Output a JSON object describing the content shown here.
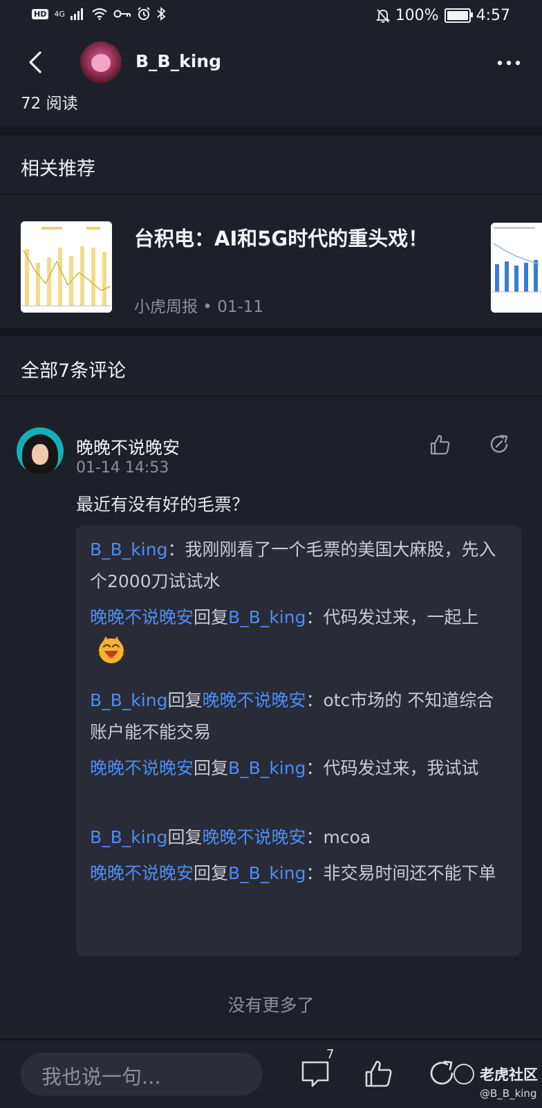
{
  "status_bar": {
    "network": "HD",
    "signal_label": "4G",
    "battery": "100%",
    "time": "4:57"
  },
  "header": {
    "username": "B_B_king",
    "reads": "72 阅读"
  },
  "recommend": {
    "section_title": "相关推荐",
    "item": {
      "title": "台积电：AI和5G时代的重头戏！",
      "meta": "小虎周报 • 01-11"
    }
  },
  "comments": {
    "section_title": "全部7条评论",
    "comment": {
      "author": "晚晚不说晚安",
      "time": "01-14 14:53",
      "text": "最近有没有好的毛票？",
      "replies": [
        {
          "user": "B_B_king",
          "verb": "",
          "target": "",
          "sep": "：",
          "text": "我刚刚看了一个毛票的美国大麻股，先入个2000刀试试水"
        },
        {
          "user": "晚晚不说晚安",
          "verb": "回复",
          "target": "B_B_king",
          "sep": "：",
          "text": "代码发过来，一起上"
        },
        {
          "user": "B_B_king",
          "verb": "回复",
          "target": "晚晚不说晚安",
          "sep": "：",
          "text": "otc市场的 不知道综合账户能不能交易"
        },
        {
          "user": "晚晚不说晚安",
          "verb": "回复",
          "target": "B_B_king",
          "sep": "：",
          "text": "代码发过来，我试试"
        },
        {
          "user": "B_B_king",
          "verb": "回复",
          "target": "晚晚不说晚安",
          "sep": "：",
          "text": "mcoa"
        },
        {
          "user": "晚晚不说晚安",
          "verb": "回复",
          "target": "B_B_king",
          "sep": "：",
          "text": "非交易时间还不能下单"
        }
      ]
    },
    "no_more": "没有更多了"
  },
  "bottom_bar": {
    "input_placeholder": "我也说一句...",
    "comment_count": "7"
  },
  "watermark": {
    "brand": "老虎社区",
    "handle": "@B_B_king"
  },
  "colors": {
    "background": "#1e2029",
    "link": "#4b8df5",
    "muted": "#8b8f9c",
    "reply_box": "#292b36"
  }
}
